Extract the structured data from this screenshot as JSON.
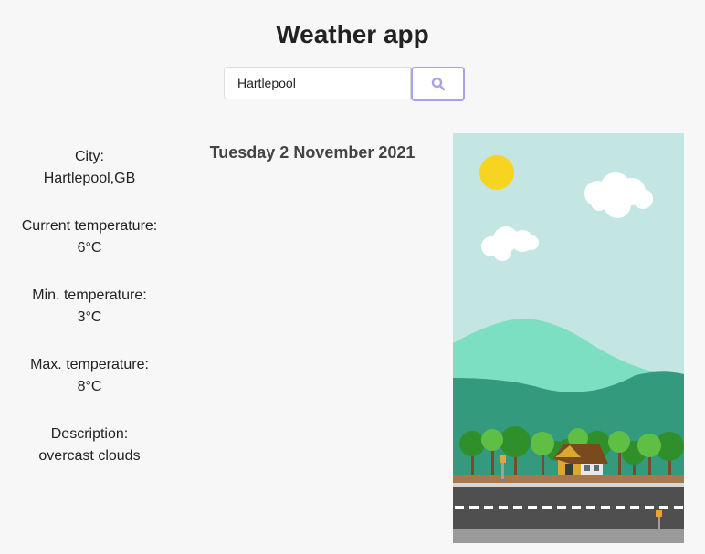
{
  "header": {
    "title": "Weather app"
  },
  "search": {
    "value": "Hartlepool",
    "icon": "search-icon"
  },
  "weather": {
    "city_label": "City:",
    "city_value": "Hartlepool,GB",
    "current_label": "Current temperature:",
    "current_value": "6°C",
    "min_label": "Min. temperature:",
    "min_value": "3°C",
    "max_label": "Max. temperature:",
    "max_value": "8°C",
    "desc_label": "Description:",
    "desc_value": "overcast clouds"
  },
  "date": "Tuesday 2 November 2021",
  "colors": {
    "background": "#f7f7f7",
    "accent": "#a9a2e8",
    "sky": "#c4e6e2",
    "sun": "#f6d420",
    "hill_light": "#7ddfc2",
    "hill_dark": "#349a7d",
    "road": "#4f4f4f"
  }
}
